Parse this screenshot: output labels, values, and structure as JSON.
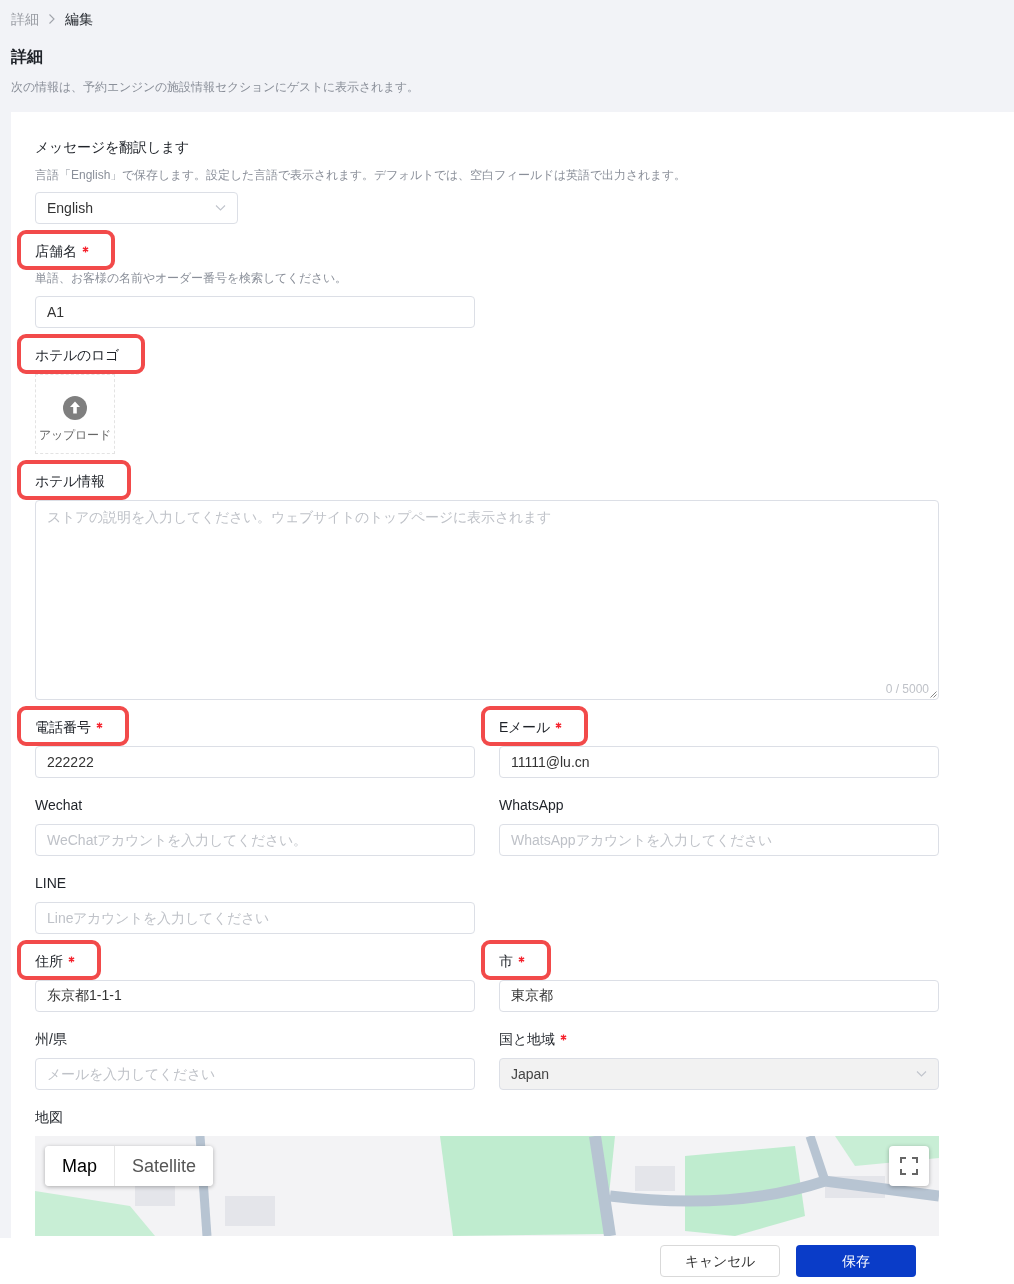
{
  "breadcrumb": [
    {
      "label": "詳細",
      "current": false
    },
    {
      "label": "編集",
      "current": true
    }
  ],
  "page": {
    "title": "詳細",
    "description": "次の情報は、予約エンジンの施設情報セクションにゲストに表示されます。"
  },
  "translation": {
    "label": "メッセージを翻訳します",
    "hint": "言語「English」で保存します。設定した言語で表示されます。デフォルトでは、空白フィールドは英語で出力されます。",
    "language": "English"
  },
  "rows": [
    [
      {
        "kind": "text",
        "label": "店舗名",
        "required": true,
        "highlighted": true,
        "hint": "単語、お客様の名前やオーダー番号を検索してください。",
        "value": "A1"
      }
    ],
    [
      {
        "kind": "upload",
        "label": "ホテルのロゴ",
        "required": false,
        "highlighted": true,
        "button": "アップロード"
      }
    ],
    [
      {
        "kind": "textarea",
        "label": "ホテル情報",
        "required": false,
        "highlighted": true,
        "placeholder": "ストアの説明を入力してください。ウェブサイトのトップページに表示されます",
        "counter": "0 / 5000"
      }
    ],
    [
      {
        "kind": "text",
        "label": "電話番号",
        "required": true,
        "highlighted": true,
        "value": "222222"
      },
      {
        "kind": "text",
        "label": "Eメール",
        "required": true,
        "highlighted": true,
        "value": "11111@lu.cn"
      }
    ],
    [
      {
        "kind": "text",
        "label": "Wechat",
        "required": false,
        "highlighted": false,
        "placeholder": "WeChatアカウントを入力してください。"
      },
      {
        "kind": "text",
        "label": "WhatsApp",
        "required": false,
        "highlighted": false,
        "placeholder": "WhatsAppアカウントを入力してください"
      }
    ],
    [
      {
        "kind": "text",
        "label": "LINE",
        "required": false,
        "highlighted": false,
        "placeholder": "Lineアカウントを入力してください"
      }
    ],
    [
      {
        "kind": "text",
        "label": "住所",
        "required": true,
        "highlighted": true,
        "value": "东京都1-1-1"
      },
      {
        "kind": "text",
        "label": "市",
        "required": true,
        "highlighted": true,
        "value": "東京都"
      }
    ],
    [
      {
        "kind": "text",
        "label": "州/県",
        "required": false,
        "highlighted": false,
        "placeholder": "メールを入力してください"
      },
      {
        "kind": "select",
        "label": "国と地域",
        "required": true,
        "highlighted": false,
        "value": "Japan",
        "disabled": true
      }
    ],
    [
      {
        "kind": "map",
        "label": "地図",
        "required": false,
        "highlighted": false,
        "map_types": [
          {
            "label": "Map",
            "selected": true
          },
          {
            "label": "Satellite",
            "selected": false
          }
        ]
      }
    ]
  ],
  "footer": {
    "buttons": [
      {
        "label": "キャンセル",
        "kind": "secondary"
      },
      {
        "label": "保存",
        "kind": "primary"
      }
    ]
  }
}
